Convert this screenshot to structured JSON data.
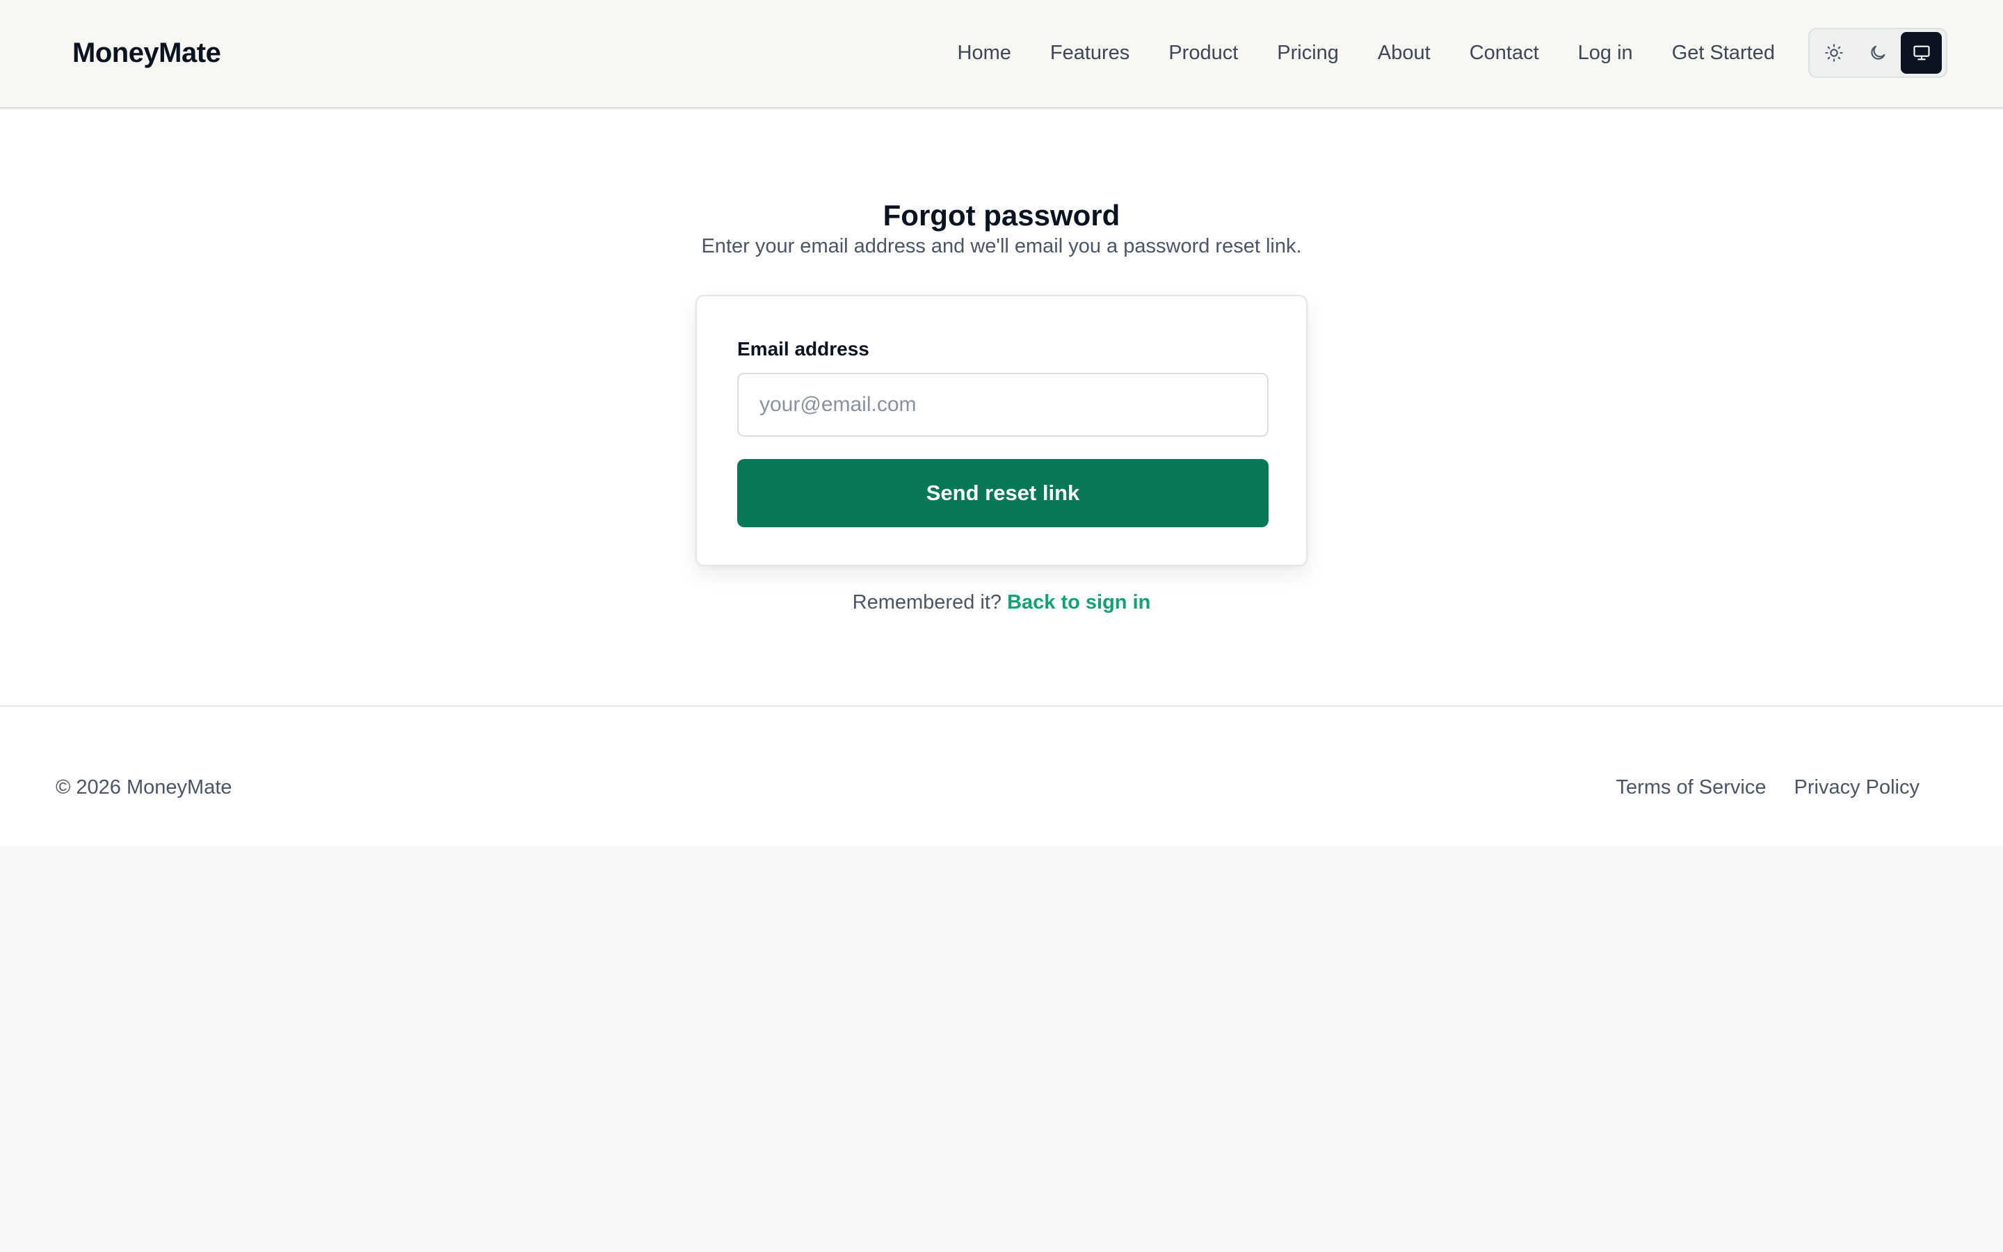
{
  "header": {
    "brand": "MoneyMate",
    "nav": {
      "home": "Home",
      "features": "Features",
      "product": "Product",
      "pricing": "Pricing",
      "about": "About",
      "contact": "Contact",
      "login": "Log in",
      "get_started": "Get Started"
    },
    "theme_switch": {
      "options": [
        "sun-icon",
        "moon-icon",
        "monitor-icon"
      ],
      "selected": "monitor-icon"
    }
  },
  "main": {
    "title": "Forgot password",
    "subtitle": "Enter your email address and we'll email you a password reset link.",
    "form": {
      "email_label": "Email address",
      "email_placeholder": "your@email.com",
      "email_value": "",
      "submit_label": "Send reset link"
    },
    "signin_prompt": "Remembered it?",
    "signin_link": "Back to sign in"
  },
  "footer": {
    "copyright": "© 2026 MoneyMate",
    "terms": "Terms of Service",
    "privacy": "Privacy Policy"
  },
  "colors": {
    "accent": "#077857",
    "link": "#10a36f",
    "header_bg": "#f7f7f3",
    "page_bg": "#f6f7f9"
  }
}
